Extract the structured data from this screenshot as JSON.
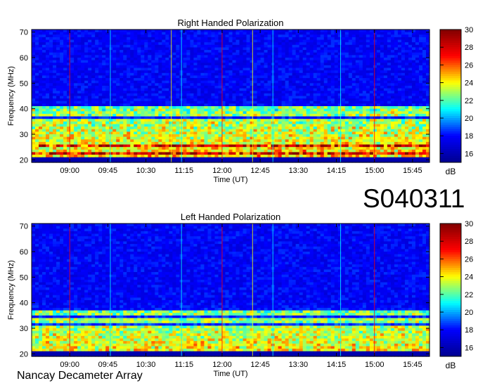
{
  "page_id": "S040311",
  "observatory": "Nancay Decameter Array",
  "chart_data": [
    {
      "type": "heatmap",
      "title": "Right Handed Polarization",
      "xlabel": "Time (UT)",
      "ylabel": "Frequency (MHz)",
      "x_ticks": [
        "09:00",
        "09:45",
        "10:30",
        "11:15",
        "12:00",
        "12:45",
        "13:30",
        "14:15",
        "15:00",
        "15:45"
      ],
      "x_tick_minutes": [
        540,
        585,
        630,
        675,
        720,
        765,
        810,
        855,
        900,
        945
      ],
      "xlim_minutes": [
        495,
        965
      ],
      "y_ticks": [
        20,
        30,
        40,
        50,
        60,
        70
      ],
      "ylim": [
        19,
        71
      ],
      "colorbar": {
        "ticks": [
          16,
          18,
          20,
          22,
          24,
          26,
          28,
          30
        ],
        "range": [
          15,
          30
        ],
        "unit": "dB",
        "colors": [
          "#00008f",
          "#0000ff",
          "#00ffff",
          "#ffff00",
          "#ff0000",
          "#800000"
        ]
      },
      "vertical_lines": [
        {
          "minute": 540,
          "color": "#ff0000"
        },
        {
          "minute": 588,
          "color": "#00ffff"
        },
        {
          "minute": 660,
          "color": "#ffff00"
        },
        {
          "minute": 672,
          "color": "#00ffff"
        },
        {
          "minute": 720,
          "color": "#ff0000"
        },
        {
          "minute": 756,
          "color": "#ffff00"
        },
        {
          "minute": 780,
          "color": "#00ffff"
        },
        {
          "minute": 860,
          "color": "#00ffff"
        },
        {
          "minute": 900,
          "color": "#ff0000"
        }
      ],
      "bands_mhz": [
        21,
        22.5,
        24,
        25.5,
        27,
        29,
        31,
        33,
        35,
        38,
        40
      ],
      "note_levels": {
        "background_db": 17,
        "band_peak_db": 28
      }
    },
    {
      "type": "heatmap",
      "title": "Left Handed Polarization",
      "xlabel": "Time (UT)",
      "ylabel": "Frequency (MHz)",
      "x_ticks": [
        "09:00",
        "09:45",
        "10:30",
        "11:15",
        "12:00",
        "12:45",
        "13:30",
        "14:15",
        "15:00",
        "15:45"
      ],
      "x_tick_minutes": [
        540,
        585,
        630,
        675,
        720,
        765,
        810,
        855,
        900,
        945
      ],
      "xlim_minutes": [
        495,
        965
      ],
      "y_ticks": [
        20,
        30,
        40,
        50,
        60,
        70
      ],
      "ylim": [
        19,
        71
      ],
      "colorbar": {
        "ticks": [
          16,
          18,
          20,
          22,
          24,
          26,
          28,
          30
        ],
        "range": [
          15,
          30
        ],
        "unit": "dB",
        "colors": [
          "#00008f",
          "#0000ff",
          "#00ffff",
          "#ffff00",
          "#ff0000",
          "#800000"
        ]
      },
      "vertical_lines": [
        {
          "minute": 540,
          "color": "#ff0000"
        },
        {
          "minute": 588,
          "color": "#00ffff"
        },
        {
          "minute": 672,
          "color": "#00ffff"
        },
        {
          "minute": 720,
          "color": "#ff0000"
        },
        {
          "minute": 756,
          "color": "#ffff00"
        },
        {
          "minute": 780,
          "color": "#00ffff"
        },
        {
          "minute": 860,
          "color": "#00ffff"
        },
        {
          "minute": 900,
          "color": "#ff0000"
        }
      ],
      "bands_mhz": [
        21,
        22,
        24,
        26,
        28,
        30,
        33,
        36
      ],
      "note_levels": {
        "background_db": 17,
        "band_peak_db": 27
      }
    }
  ]
}
